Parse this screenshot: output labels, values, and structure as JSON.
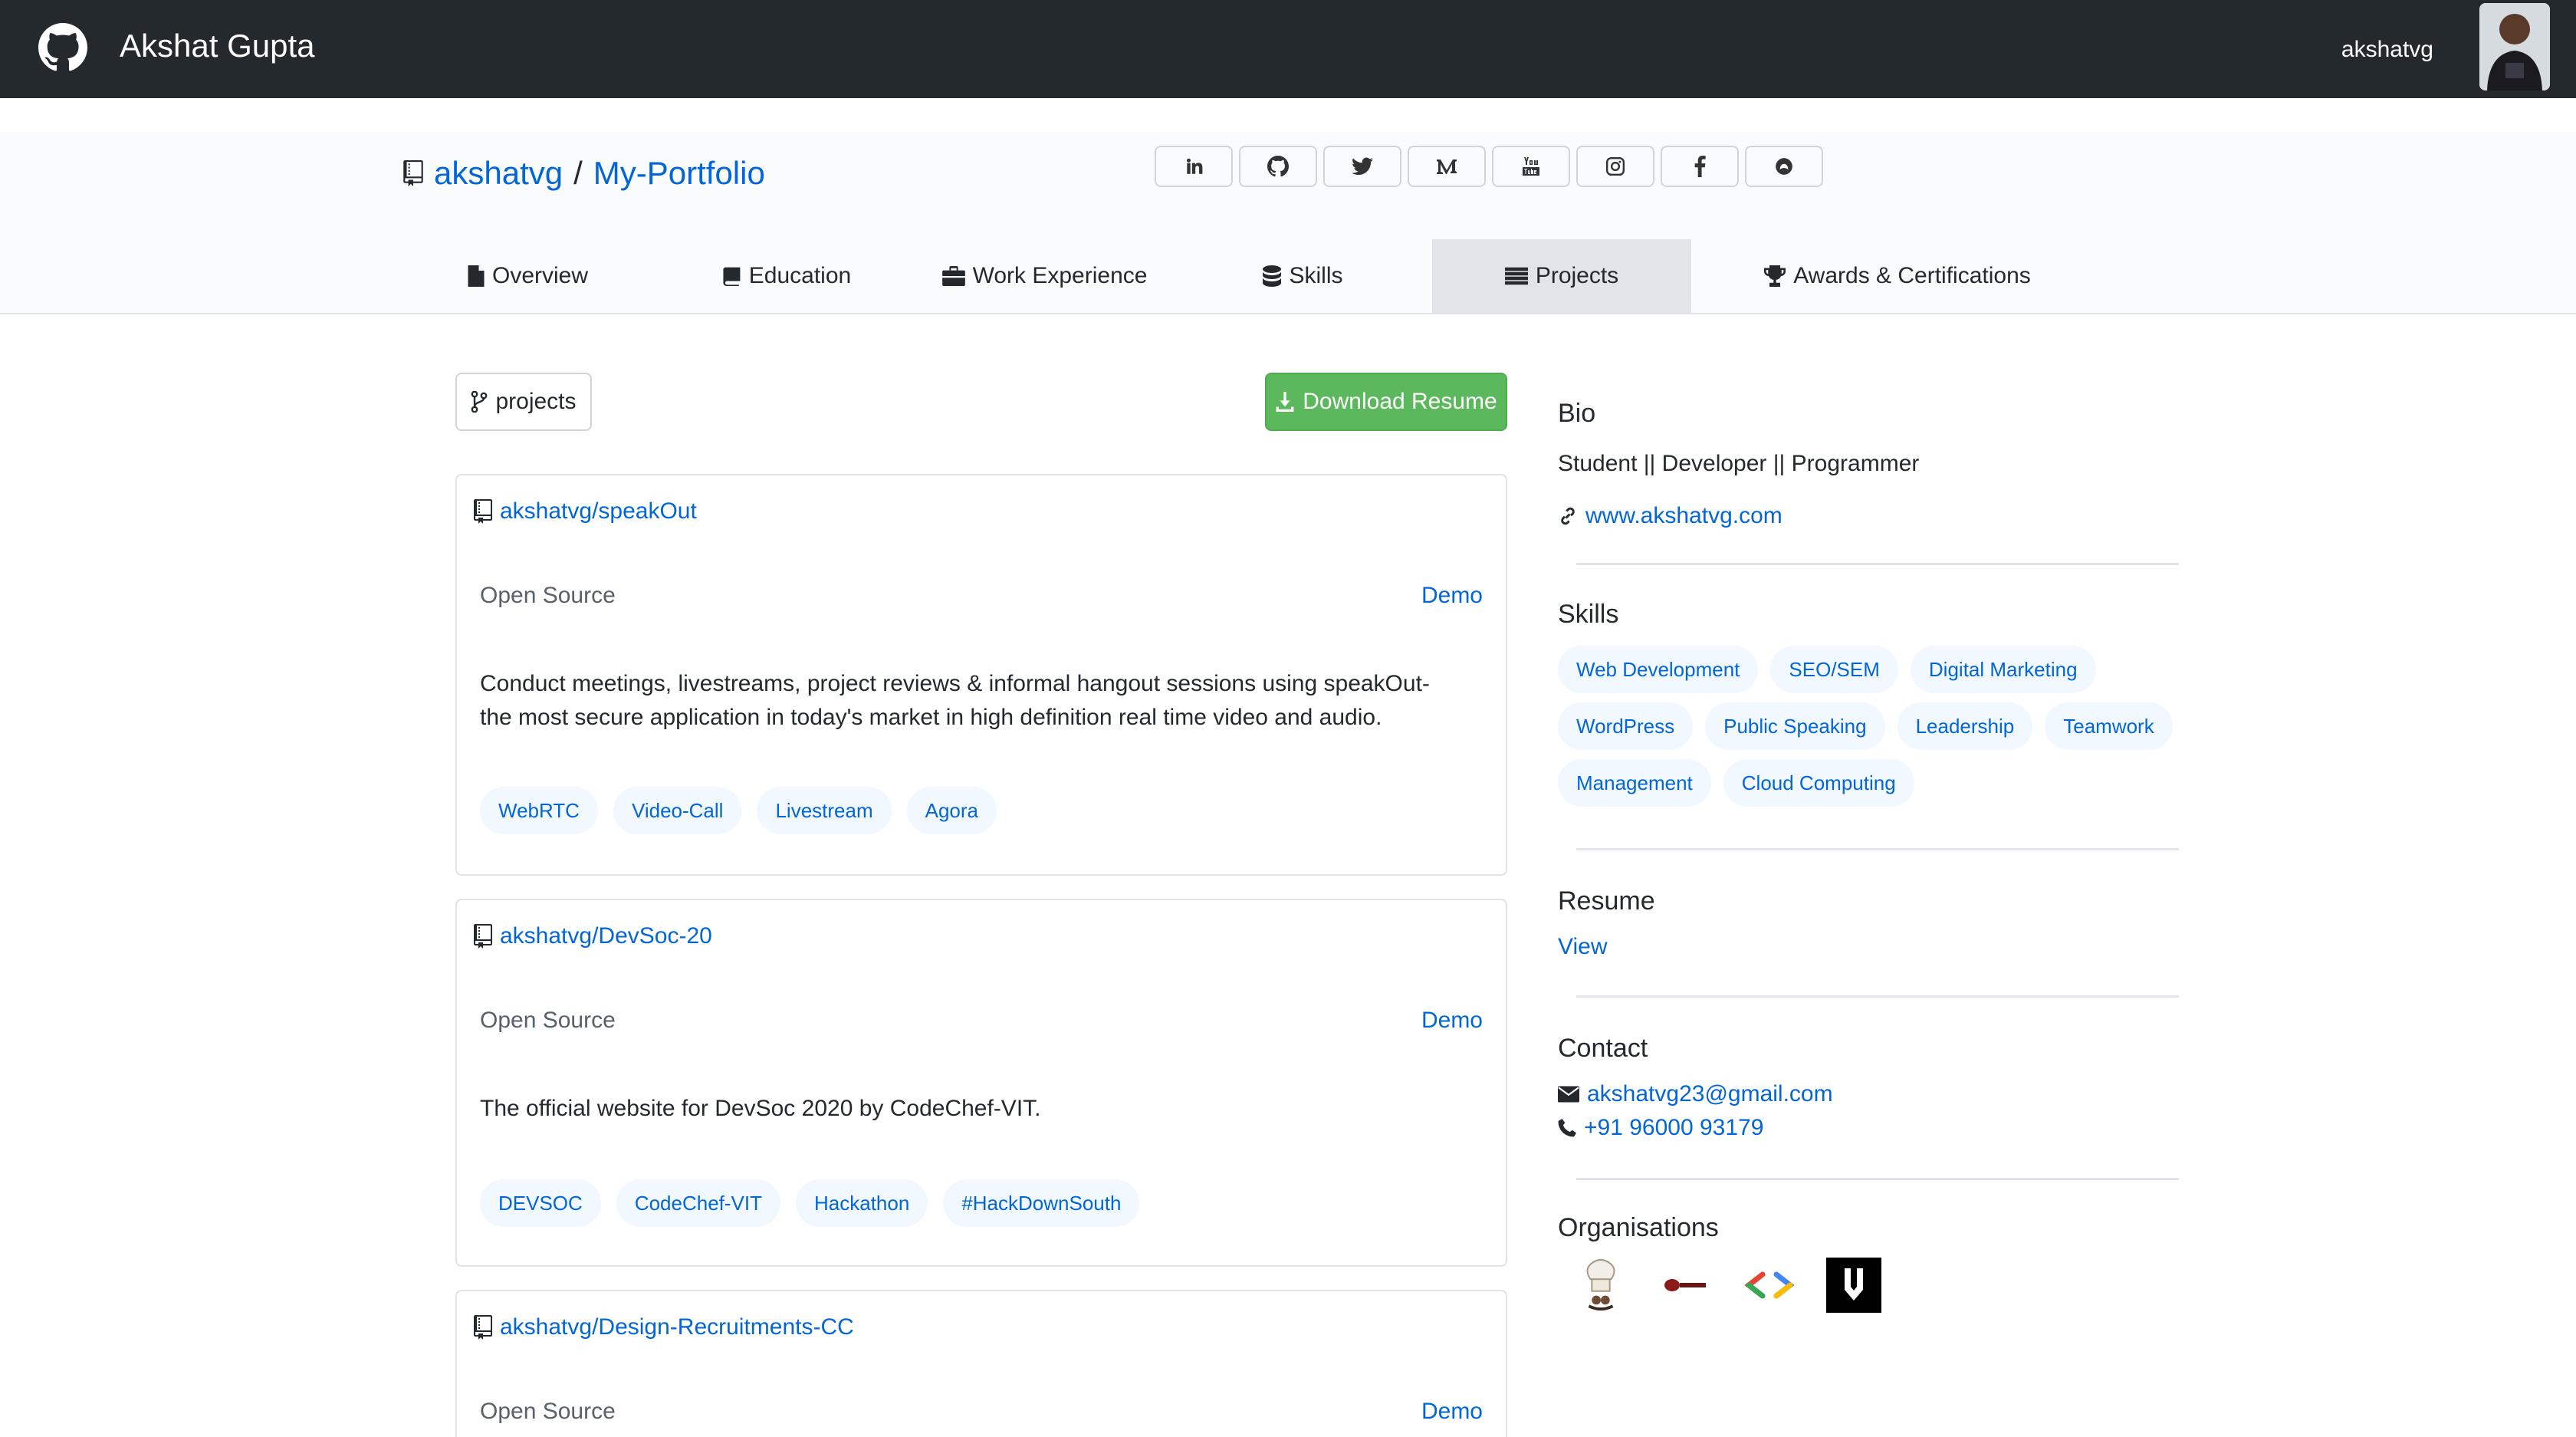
{
  "header": {
    "brand": "Akshat Gupta",
    "username": "akshatvg"
  },
  "repo": {
    "owner": "akshatvg",
    "separator": "/",
    "name": "My-Portfolio"
  },
  "social_icons": [
    "linkedin-icon",
    "github-icon",
    "twitter-icon",
    "medium-icon",
    "youtube-icon",
    "instagram-icon",
    "facebook-icon",
    "codechef-icon"
  ],
  "tabs": [
    {
      "label": "Overview",
      "icon": "file-icon",
      "active": false
    },
    {
      "label": "Education",
      "icon": "book-icon",
      "active": false
    },
    {
      "label": "Work Experience",
      "icon": "briefcase-icon",
      "active": false
    },
    {
      "label": "Skills",
      "icon": "database-icon",
      "active": false
    },
    {
      "label": "Projects",
      "icon": "list-icon",
      "active": true
    },
    {
      "label": "Awards & Certifications",
      "icon": "trophy-icon",
      "active": false
    }
  ],
  "main": {
    "branch_label": "projects",
    "download_label": "Download Resume"
  },
  "projects": [
    {
      "title": "akshatvg/speakOut",
      "kind": "Open Source",
      "demo": "Demo",
      "description": "Conduct meetings, livestreams, project reviews & informal hangout sessions using speakOut- the most secure application in today's market in high definition real time video and audio.",
      "tags": [
        "WebRTC",
        "Video-Call",
        "Livestream",
        "Agora"
      ]
    },
    {
      "title": "akshatvg/DevSoc-20",
      "kind": "Open Source",
      "demo": "Demo",
      "description": "The official website for DevSoc 2020 by CodeChef-VIT.",
      "tags": [
        "DEVSOC",
        "CodeChef-VIT",
        "Hackathon",
        "#HackDownSouth"
      ]
    },
    {
      "title": "akshatvg/Design-Recruitments-CC",
      "kind": "Open Source",
      "demo": "Demo"
    }
  ],
  "sidebar": {
    "bio_heading": "Bio",
    "bio_text": "Student || Developer || Programmer",
    "website": "www.akshatvg.com",
    "skills_heading": "Skills",
    "skills": [
      "Web Development",
      "SEO/SEM",
      "Digital Marketing",
      "WordPress",
      "Public Speaking",
      "Leadership",
      "Teamwork",
      "Management",
      "Cloud Computing"
    ],
    "resume_heading": "Resume",
    "resume_link": "View",
    "contact_heading": "Contact",
    "email": "akshatvg23@gmail.com",
    "phone": "+91 96000 93179",
    "organisations_heading": "Organisations",
    "organisations": [
      "codechef-vit-logo",
      "org-logo-2",
      "google-dsc-logo",
      "org-logo-4"
    ]
  },
  "colors": {
    "topbar": "#24292e",
    "link": "#0366d6",
    "download_button": "#5cb85c",
    "chip_bg": "#f1f8ff",
    "active_tab": "#e1e4e8"
  }
}
